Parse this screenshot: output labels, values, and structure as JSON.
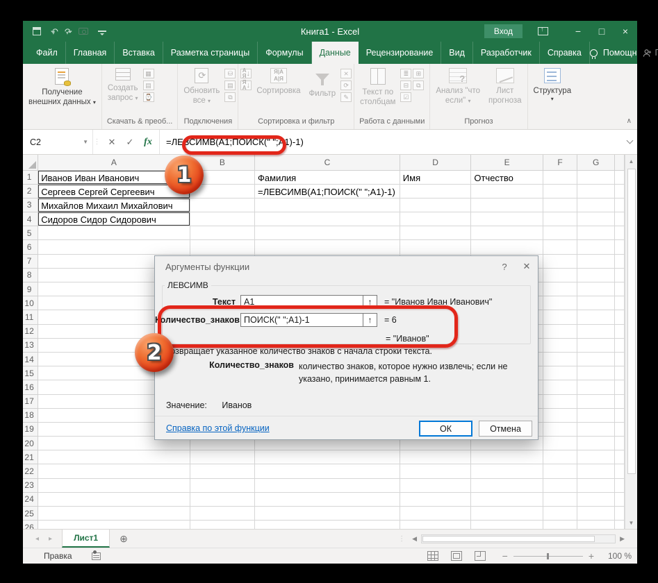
{
  "window": {
    "title": "Книга1  -  Excel",
    "signin_label": "Вход"
  },
  "menu_tabs": [
    {
      "label": "Файл",
      "active": false
    },
    {
      "label": "Главная",
      "active": false
    },
    {
      "label": "Вставка",
      "active": false
    },
    {
      "label": "Разметка страницы",
      "active": false
    },
    {
      "label": "Формулы",
      "active": false
    },
    {
      "label": "Данные",
      "active": true
    },
    {
      "label": "Рецензирование",
      "active": false
    },
    {
      "label": "Вид",
      "active": false
    },
    {
      "label": "Разработчик",
      "active": false
    },
    {
      "label": "Справка",
      "active": false
    }
  ],
  "menu_extras": {
    "assistant": "Помощн",
    "share": "Поделиться"
  },
  "ribbon": {
    "get_external_1": "Получение",
    "get_external_2": "внешних данных",
    "create_query_1": "Создать",
    "create_query_2": "запрос",
    "refresh_all_1": "Обновить",
    "refresh_all_2": "все",
    "sort_label": "Сортировка",
    "filter_label": "Фильтр",
    "text_to_columns_1": "Текст по",
    "text_to_columns_2": "столбцам",
    "what_if_1": "Анализ \"что",
    "what_if_2": "если\"",
    "forecast_1": "Лист",
    "forecast_2": "прогноза",
    "structure_label": "Структура",
    "caption_get_transform": "Скачать & преоб...",
    "caption_connections": "Подключения",
    "caption_sort_filter": "Сортировка и фильтр",
    "caption_data_tools": "Работа с данными",
    "caption_forecast": "Прогноз"
  },
  "formula_bar": {
    "name_box": "C2",
    "formula": "=ЛЕВСИМВ(A1;ПОИСК(\" \";A1)-1)"
  },
  "grid": {
    "columns": [
      "A",
      "B",
      "C",
      "D",
      "E",
      "F",
      "G"
    ],
    "row_count": 26,
    "cells": {
      "A1": "Иванов Иван Иванович",
      "A2": "Сергеев Сергей Сергеевич",
      "A3": "Михайлов Михаил Михайлович",
      "A4": "Сидоров Сидор Сидорович",
      "C1": "Фамилия",
      "D1": "Имя",
      "E1": "Отчество",
      "C2": "=ЛЕВСИМВ(A1;ПОИСК(\" \";A1)-1)"
    },
    "bordered_cells": [
      "A1",
      "A2",
      "A3",
      "A4"
    ],
    "spill_cells": [
      "C2"
    ]
  },
  "dialog": {
    "title": "Аргументы функции",
    "function_name": "ЛЕВСИМВ",
    "fields": [
      {
        "label": "Текст",
        "value": "A1",
        "result": "=  \"Иванов Иван Иванович\""
      },
      {
        "label": "Количество_знаков",
        "value": "ПОИСК(\" \";A1)-1",
        "result": "=  6"
      }
    ],
    "formula_result": "=  \"Иванов\"",
    "description": "Возвращает указанное количество знаков с начала строки текста.",
    "param_name": "Количество_знаков",
    "param_help": "количество знаков, которое нужно извлечь; если не указано, принимается равным 1.",
    "value_label": "Значение:",
    "value": "Иванов",
    "help_link": "Справка по этой функции",
    "ok_label": "ОК",
    "cancel_label": "Отмена"
  },
  "sheet_bar": {
    "active_tab": "Лист1"
  },
  "status_bar": {
    "mode": "Правка",
    "zoom": "100 %"
  },
  "annotations": {
    "step1": "1",
    "step2": "2"
  },
  "colors": {
    "excel_green": "#217346",
    "annotation_red": "#E2261A",
    "link_blue": "#0563C1",
    "default_button_border": "#0078D7"
  }
}
